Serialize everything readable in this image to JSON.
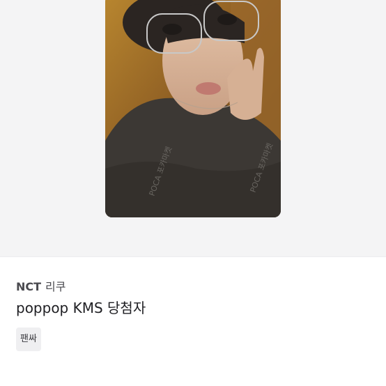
{
  "listing": {
    "image": {
      "watermark": "POCA 포카마켓"
    },
    "group": "NCT",
    "member": "리쿠",
    "title": "poppop KMS 당첨자",
    "tag": "팬싸"
  },
  "colors": {
    "photo_background": "#f4f4f5",
    "tag_background": "#efeff1",
    "title_text": "#1f1f23"
  }
}
